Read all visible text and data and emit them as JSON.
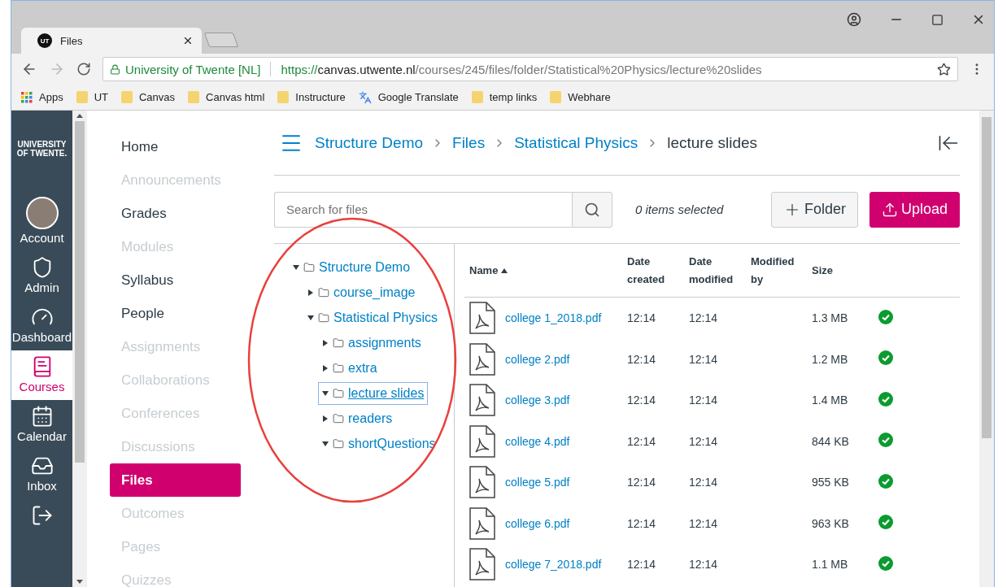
{
  "browser": {
    "tab": {
      "title": "Files",
      "favicon": "UT"
    },
    "security_label": "University of Twente [NL]",
    "url_scheme": "https://",
    "url_host": "canvas.utwente.nl",
    "url_path": "/courses/245/files/folder/Statistical%20Physics/lecture%20slides",
    "bookmarks": [
      {
        "kind": "apps",
        "label": "Apps"
      },
      {
        "kind": "folder",
        "label": "UT"
      },
      {
        "kind": "folder",
        "label": "Canvas"
      },
      {
        "kind": "folder",
        "label": "Canvas html"
      },
      {
        "kind": "folder",
        "label": "Instructure"
      },
      {
        "kind": "translate",
        "label": "Google Translate"
      },
      {
        "kind": "folder",
        "label": "temp links"
      },
      {
        "kind": "folder",
        "label": "Webhare"
      }
    ]
  },
  "global_nav": {
    "logo": "UNIVERSITY OF TWENTE.",
    "items": [
      {
        "kind": "avatar",
        "label": "Account",
        "selected": false
      },
      {
        "kind": "admin",
        "label": "Admin",
        "selected": false
      },
      {
        "kind": "dashboard",
        "label": "Dashboard",
        "selected": false
      },
      {
        "kind": "courses",
        "label": "Courses",
        "selected": true
      },
      {
        "kind": "calendar",
        "label": "Calendar",
        "selected": false
      },
      {
        "kind": "inbox",
        "label": "Inbox",
        "selected": false
      },
      {
        "kind": "logout",
        "selected": false
      }
    ]
  },
  "course_nav": [
    {
      "label": "Home",
      "disabled": false,
      "selected": false
    },
    {
      "label": "Announcements",
      "disabled": true,
      "selected": false
    },
    {
      "label": "Grades",
      "disabled": false,
      "selected": false
    },
    {
      "label": "Modules",
      "disabled": true,
      "selected": false
    },
    {
      "label": "Syllabus",
      "disabled": false,
      "selected": false
    },
    {
      "label": "People",
      "disabled": false,
      "selected": false
    },
    {
      "label": "Assignments",
      "disabled": true,
      "selected": false
    },
    {
      "label": "Collaborations",
      "disabled": true,
      "selected": false
    },
    {
      "label": "Conferences",
      "disabled": true,
      "selected": false
    },
    {
      "label": "Discussions",
      "disabled": true,
      "selected": false
    },
    {
      "label": "Files",
      "disabled": false,
      "selected": true
    },
    {
      "label": "Outcomes",
      "disabled": true,
      "selected": false
    },
    {
      "label": "Pages",
      "disabled": true,
      "selected": false
    },
    {
      "label": "Quizzes",
      "disabled": true,
      "selected": false
    }
  ],
  "breadcrumbs": [
    {
      "label": "Structure Demo",
      "link": true
    },
    {
      "label": "Files",
      "link": true
    },
    {
      "label": "Statistical Physics",
      "link": true
    },
    {
      "label": "lecture slides",
      "link": false
    }
  ],
  "search": {
    "placeholder": "Search for files"
  },
  "selection_count": "0 items selected",
  "buttons": [
    {
      "kind": "folder",
      "label": "Folder"
    },
    {
      "kind": "upload",
      "label": "Upload"
    }
  ],
  "tree": [
    {
      "label": "Structure Demo",
      "expanded": true,
      "selected": false,
      "children": [
        {
          "label": "course_image",
          "expanded": false,
          "selected": false
        },
        {
          "label": "Statistical Physics",
          "expanded": true,
          "selected": false,
          "children": [
            {
              "label": "assignments",
              "expanded": false,
              "selected": false
            },
            {
              "label": "extra",
              "expanded": false,
              "selected": false
            },
            {
              "label": "lecture slides",
              "expanded": true,
              "selected": true
            },
            {
              "label": "readers",
              "expanded": false,
              "selected": false
            },
            {
              "label": "shortQuestions",
              "expanded": true,
              "selected": false
            }
          ]
        }
      ]
    }
  ],
  "table": {
    "columns": [
      {
        "label": "Name",
        "sorted": true
      },
      {
        "label": "Date created",
        "sorted": false
      },
      {
        "label": "Date modified",
        "sorted": false
      },
      {
        "label": "Modified by",
        "sorted": false
      },
      {
        "label": "Size",
        "sorted": false
      }
    ],
    "rows": [
      {
        "name": "college 1_2018.pdf",
        "created": "12:14",
        "modified": "12:14",
        "size": "1.3 MB",
        "published": true
      },
      {
        "name": "college 2.pdf",
        "created": "12:14",
        "modified": "12:14",
        "size": "1.2 MB",
        "published": true
      },
      {
        "name": "college 3.pdf",
        "created": "12:14",
        "modified": "12:14",
        "size": "1.4 MB",
        "published": true
      },
      {
        "name": "college 4.pdf",
        "created": "12:14",
        "modified": "12:14",
        "size": "844 KB",
        "published": true
      },
      {
        "name": "college 5.pdf",
        "created": "12:14",
        "modified": "12:14",
        "size": "955 KB",
        "published": true
      },
      {
        "name": "college 6.pdf",
        "created": "12:14",
        "modified": "12:14",
        "size": "963 KB",
        "published": true
      },
      {
        "name": "college 7_2018.pdf",
        "created": "12:14",
        "modified": "12:14",
        "size": "1.1 MB",
        "published": true
      }
    ]
  }
}
